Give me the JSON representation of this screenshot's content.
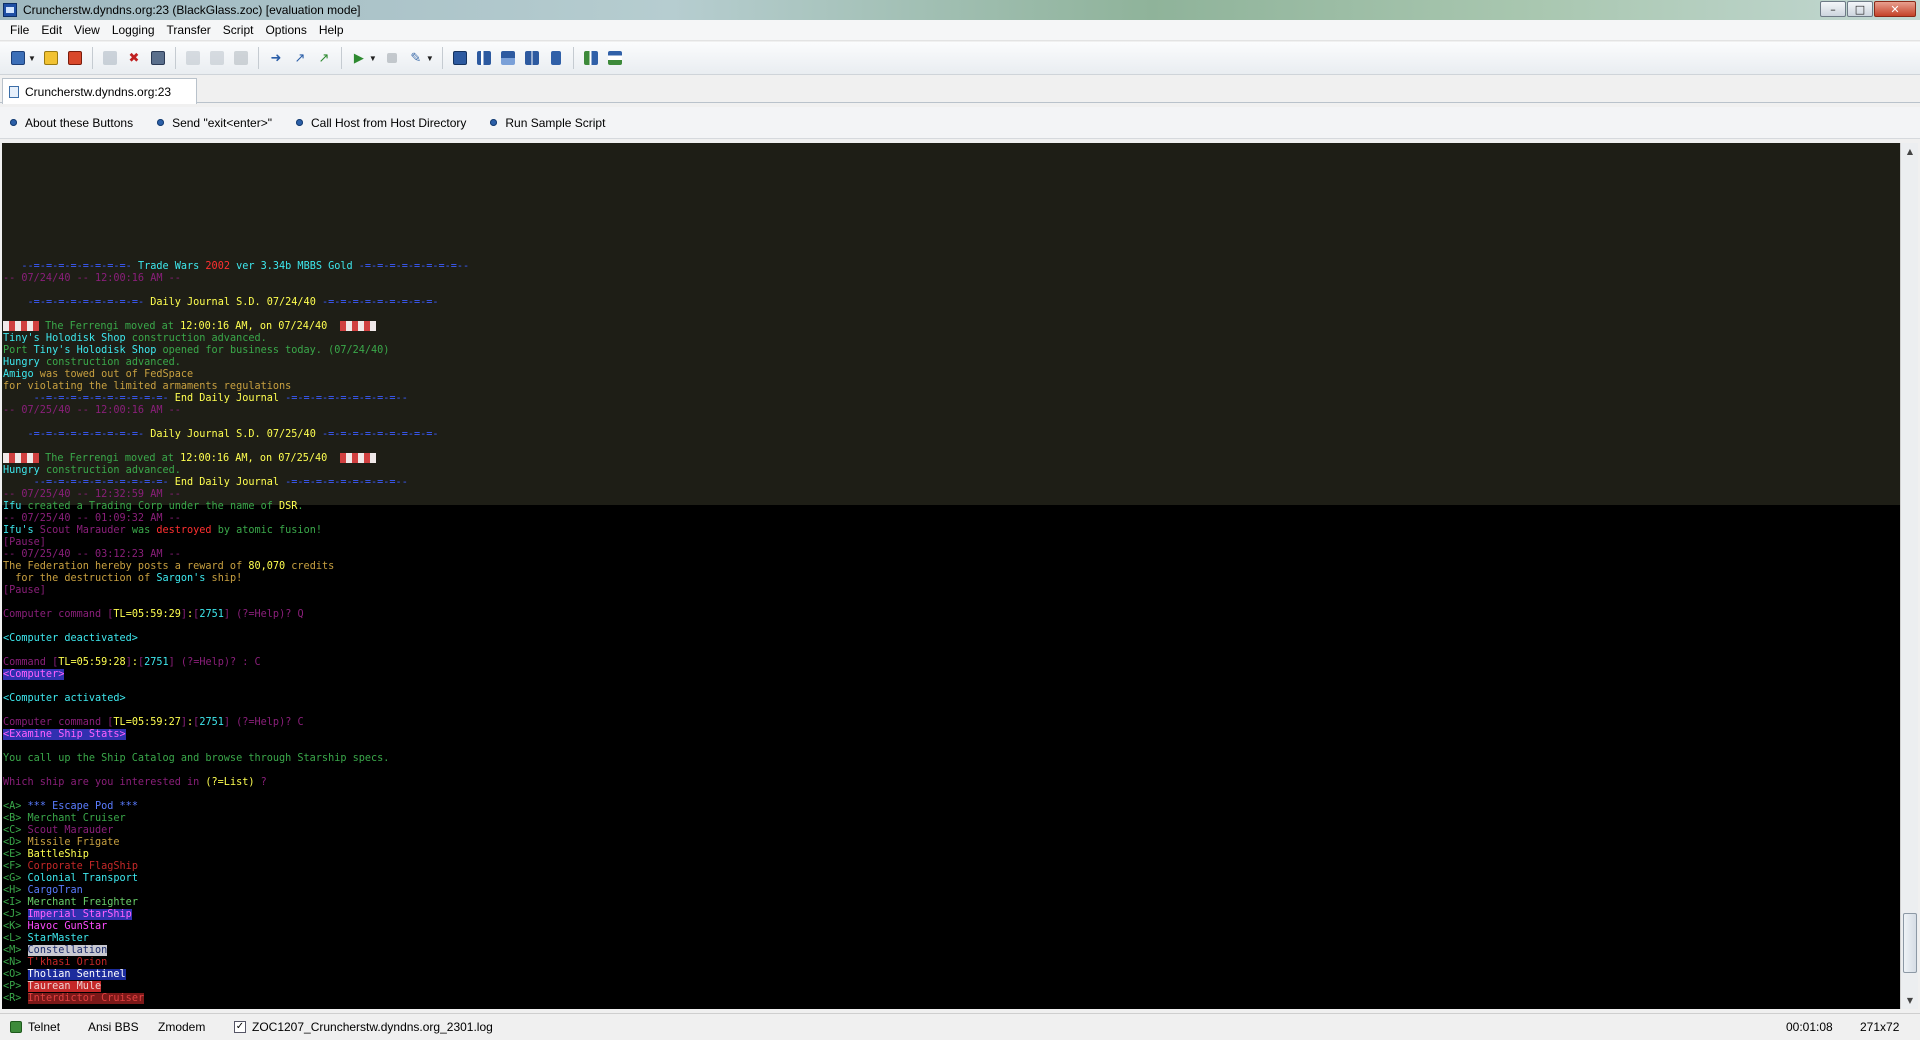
{
  "window": {
    "title": "Cruncherstw.dyndns.org:23 (BlackGlass.zoc) [evaluation mode]"
  },
  "menu": [
    "File",
    "Edit",
    "View",
    "Logging",
    "Transfer",
    "Script",
    "Options",
    "Help"
  ],
  "toolbar_icons": [
    "quick-connect-icon",
    "favorites-icon",
    "disconnect-icon",
    "clone-icon",
    "close-session-icon",
    "copy-icon",
    "paste-icon",
    "print-icon",
    "send-file-icon",
    "receive-file-icon",
    "upload-icon",
    "run-script-icon",
    "stop-icon",
    "edit-icon",
    "terminal-icon",
    "stats-icon",
    "hosts-icon",
    "keyboard-icon",
    "map-icon",
    "config-icon",
    "layout-icon"
  ],
  "tab": {
    "label": "Cruncherstw.dyndns.org:23"
  },
  "user_buttons": [
    "About these Buttons",
    "Send \"exit<enter>\"",
    "Call Host from Host Directory",
    "Run Sample Script"
  ],
  "terminal": {
    "banner_dashes_left": "--=-=-=-=-=-=-=-=-",
    "banner_title": " Trade Wars ",
    "banner_year": "2002",
    "banner_ver": " ver 3.34b MBBS Gold ",
    "banner_dashes_right": "-=-=-=-=-=-=-=-=--",
    "date1": "-- 07/24/40 -- 12:00:16 AM --",
    "journal_dashes": "-=-=-=-=-=-=-=-=-=-",
    "journal_title1": " Daily Journal S.D. 07/24/40 ",
    "ferrengi_moved": " The Ferrengi moved at ",
    "time_1216": "12:00:16 AM",
    "on_date1": ", on 07/24/40",
    "tiny_holodisk": "Tiny's Holodisk Shop",
    "construction_adv": " construction advanced.",
    "port": "Port ",
    "opened_business": " opened for business today. (07/24/40)",
    "hungry": "Hungry",
    "amigo": "Amigo",
    "towed": " was towed out of FedSpace",
    "violating": "for violating the limited armaments regulations",
    "end_dashes": "--=-=-=-=-=-=-=-=-=-=-",
    "end_journal": " End Daily Journal ",
    "end_dashes_r": "-=-=-=-=-=-=-=-=-=--",
    "date2": "-- 07/25/40 -- 12:00:16 AM --",
    "journal_title2": " Daily Journal S.D. 07/25/40 ",
    "on_date2": ", on 07/25/40",
    "date3": "-- 07/25/40 -- 12:32:59 AM --",
    "ifu": "Ifu",
    "created_corp": " created a Trading Corp under the name of ",
    "dsr": "DSR",
    "dot": ".",
    "date4": "-- 07/25/40 -- 01:09:32 AM --",
    "ifus": "Ifu's",
    "scout_marauder": " Scout Marauder",
    "was": " was ",
    "destroyed": "destroyed",
    "atomic": " by atomic fusion!",
    "pause": "[Pause]",
    "date5": "-- 07/25/40 -- 03:12:23 AM --",
    "federation": "The Federation hereby posts a reward of ",
    "reward": "80,070",
    "credits": " credits",
    "for_destruction": "  for the destruction of ",
    "sargons": "Sargon's",
    "ship_excl": " ship!",
    "computer_command": "Computer command ",
    "lb": "[",
    "rb": "]",
    "tl1": "TL=05:59:29",
    "colon": ":",
    "sector": "2751",
    "help": " (?=Help)? ",
    "q": "Q",
    "comp_deactivated": "<Computer deactivated>",
    "command": "Command ",
    "tl2": "TL=05:59:28",
    "help2": " (?=Help)? : ",
    "c": "C",
    "computer_tag": "<Computer>",
    "comp_activated": "<Computer activated>",
    "tl3": "TL=05:59:27",
    "examine": "<Examine Ship Stats>",
    "catalog": "You call up the Ship Catalog and browse through Starship specs.",
    "which_ship": "Which ship are you interested in ",
    "list_opt": "(?=List)",
    "q_mark": " ?",
    "ships": [
      {
        "key": "<A> ",
        "name": "*** Escape Pod ***"
      },
      {
        "key": "<B> ",
        "name": "Merchant Cruiser"
      },
      {
        "key": "<C> ",
        "name": "Scout Marauder"
      },
      {
        "key": "<D> ",
        "name": "Missile Frigate"
      },
      {
        "key": "<E> ",
        "name": "BattleShip"
      },
      {
        "key": "<F> ",
        "name": "Corporate FlagShip"
      },
      {
        "key": "<G> ",
        "name": "Colonial Transport"
      },
      {
        "key": "<H> ",
        "name": "CargoTran"
      },
      {
        "key": "<I> ",
        "name": "Merchant Freighter"
      },
      {
        "key": "<J> ",
        "name": "Imperial StarShip"
      },
      {
        "key": "<K> ",
        "name": "Havoc GunStar"
      },
      {
        "key": "<L> ",
        "name": "StarMaster"
      },
      {
        "key": "<M> ",
        "name": "Constellation"
      },
      {
        "key": "<N> ",
        "name": "T'khasi Orion"
      },
      {
        "key": "<O> ",
        "name": "Tholian Sentinel"
      },
      {
        "key": "<P> ",
        "name": "Taurean Mule"
      },
      {
        "key": "<R> ",
        "name": "Interdictor Cruiser"
      }
    ]
  },
  "status": {
    "telnet": "Telnet",
    "emulation": "Ansi BBS",
    "transfer": "Zmodem",
    "logfile": "ZOC1207_Cruncherstw.dyndns.org_2301.log",
    "elapsed": "00:01:08",
    "size": "271x72"
  }
}
